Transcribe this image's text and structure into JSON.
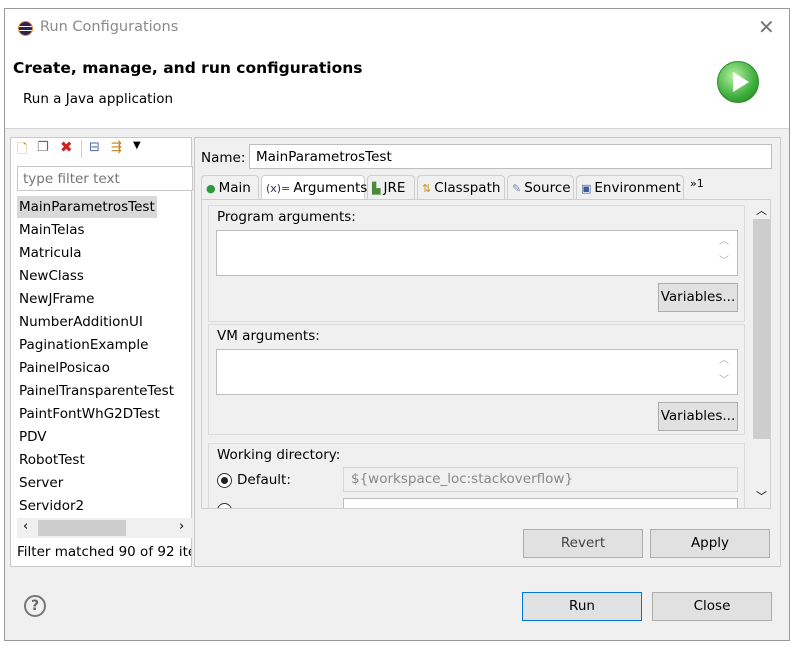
{
  "window": {
    "title": "Run Configurations",
    "close_icon": "close-icon"
  },
  "header": {
    "title": "Create, manage, and run configurations",
    "subtitle": "Run a Java application",
    "icon": "run-play-icon",
    "accent": "#3cae3c"
  },
  "left": {
    "toolbar": [
      "new-config-icon",
      "duplicate-icon",
      "delete-icon",
      "collapse-all-icon",
      "filter-icon",
      "dropdown-arrow-icon"
    ],
    "filter_placeholder": "type filter text",
    "items": [
      "MainParametrosTest",
      "MainTelas",
      "Matricula",
      "NewClass",
      "NewJFrame",
      "NumberAdditionUI",
      "PaginationExample",
      "PainelPosicao",
      "PainelTransparenteTest",
      "PaintFontWhG2DTest",
      "PDV",
      "RobotTest",
      "Server",
      "Servidor2"
    ],
    "selected": "MainParametrosTest",
    "status": "Filter matched 90 of 92 ite"
  },
  "right": {
    "name_label": "Name:",
    "name_value": "MainParametrosTest",
    "tabs": [
      {
        "label": "Main",
        "icon": "main-class-icon"
      },
      {
        "label": "Arguments",
        "icon": "arguments-icon"
      },
      {
        "label": "JRE",
        "icon": "jre-library-icon"
      },
      {
        "label": "Classpath",
        "icon": "classpath-icon"
      },
      {
        "label": "Source",
        "icon": "source-icon"
      },
      {
        "label": "Environment",
        "icon": "environment-icon"
      }
    ],
    "more_tabs": "»1",
    "active_tab": "Arguments",
    "program_args_label": "Program arguments:",
    "program_args_value": "",
    "vm_args_label": "VM arguments:",
    "vm_args_value": "",
    "variables_label": "Variables...",
    "working_dir_label": "Working directory:",
    "default_label": "Default:",
    "default_value": "${workspace_loc:stackoverflow}",
    "revert": "Revert",
    "apply": "Apply"
  },
  "footer": {
    "help_icon": "help-icon",
    "run": "Run",
    "close": "Close"
  }
}
